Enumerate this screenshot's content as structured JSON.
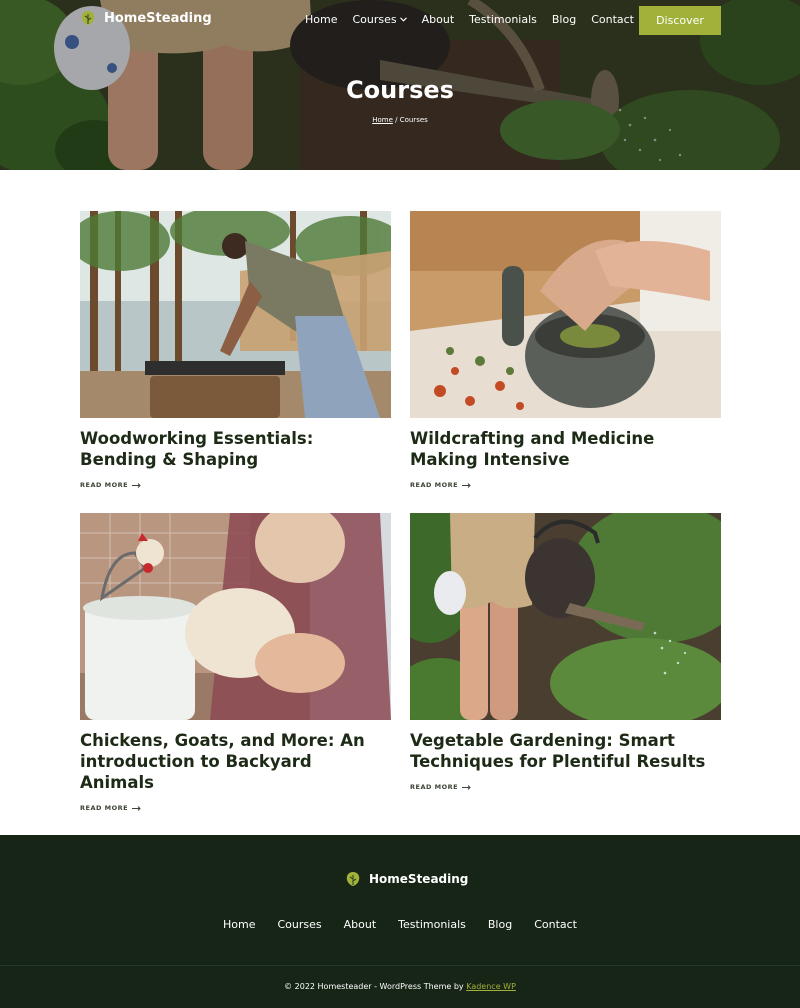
{
  "brand": {
    "name": "HomeSteading",
    "accent": "#a2b13a",
    "footer_bg": "#162516"
  },
  "nav": {
    "items": [
      "Home",
      "Courses",
      "About",
      "Testimonials",
      "Blog",
      "Contact"
    ],
    "courses_has_dropdown": true,
    "cta_label": "Discover"
  },
  "hero": {
    "title": "Courses",
    "breadcrumb": {
      "home": "Home",
      "separator": "/",
      "current": "Courses"
    }
  },
  "courses": [
    {
      "title": "Woodworking Essentials: Bending & Shaping",
      "cta": "READ MORE",
      "image": "woodworking-photo"
    },
    {
      "title": "Wildcrafting and Medicine Making Intensive",
      "cta": "READ MORE",
      "image": "mortar-pestle-herbs-photo"
    },
    {
      "title": "Chickens, Goats, and More: An introduction to Backyard Animals",
      "cta": "READ MORE",
      "image": "chicken-photo"
    },
    {
      "title": "Vegetable Gardening: Smart Techniques for Plentiful Results",
      "cta": "READ MORE",
      "image": "watering-garden-photo"
    }
  ],
  "footer": {
    "brand": "HomeSteading",
    "nav": [
      "Home",
      "Courses",
      "About",
      "Testimonials",
      "Blog",
      "Contact"
    ],
    "copyright_prefix": "© 2022 Homesteader - WordPress Theme by",
    "copyright_link": "Kadence WP"
  }
}
